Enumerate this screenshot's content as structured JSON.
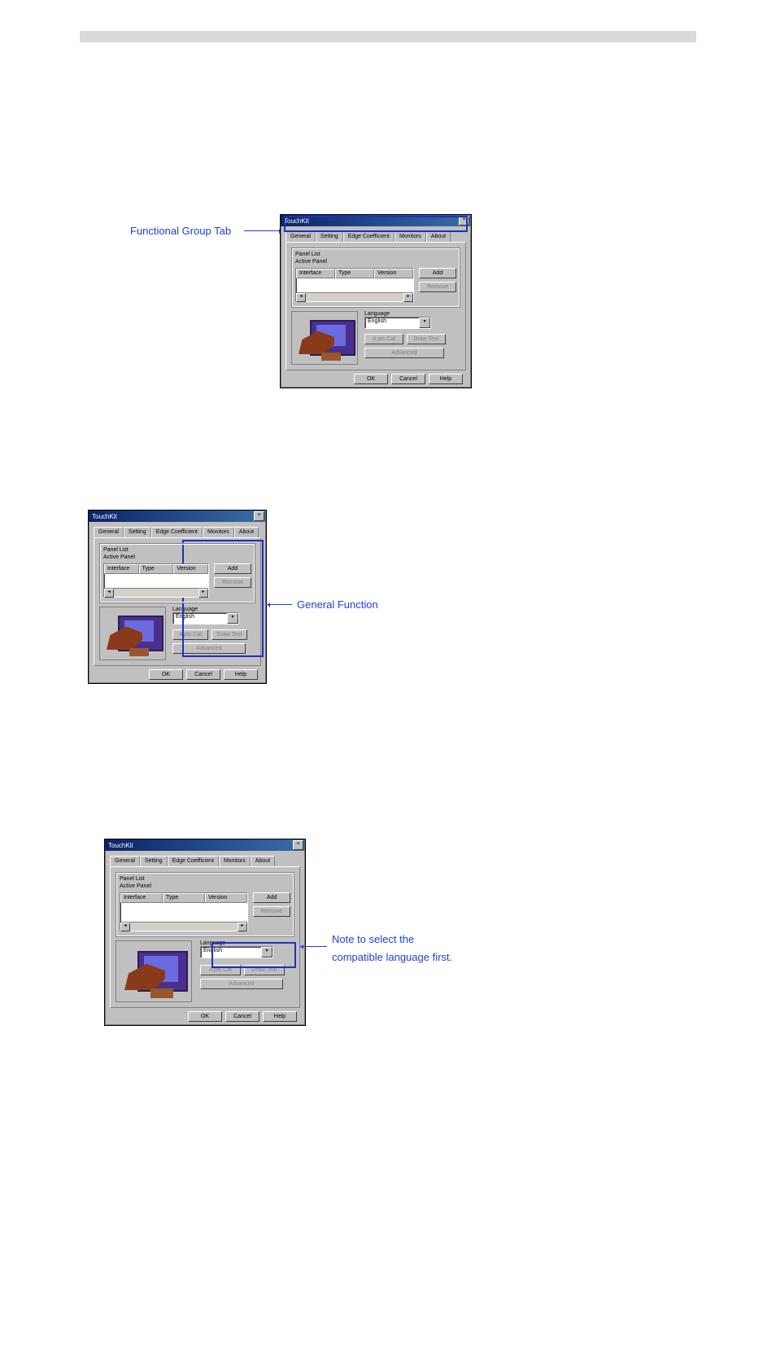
{
  "dialog": {
    "title": "TouchKit",
    "tabs": [
      "General",
      "Setting",
      "Edge Coefficient",
      "Monitors",
      "About"
    ],
    "panel_list_label": "Panel List",
    "active_panel_label": "Active Panel",
    "columns": [
      "Interface",
      "Type",
      "Version"
    ],
    "add_btn": "Add",
    "remove_btn": "Remove",
    "lang_label": "Language",
    "lang_value": "English",
    "btn_4pt": "4 pts Cal",
    "btn_drawtest": "Draw Test",
    "btn_advanced": "Advanced",
    "ok": "OK",
    "cancel": "Cancel",
    "help": "Help"
  },
  "callouts": {
    "func_tab": "Functional Group Tab",
    "general_func": "General Function",
    "note_line1": "Note to select the",
    "note_line2": "compatible language first."
  }
}
